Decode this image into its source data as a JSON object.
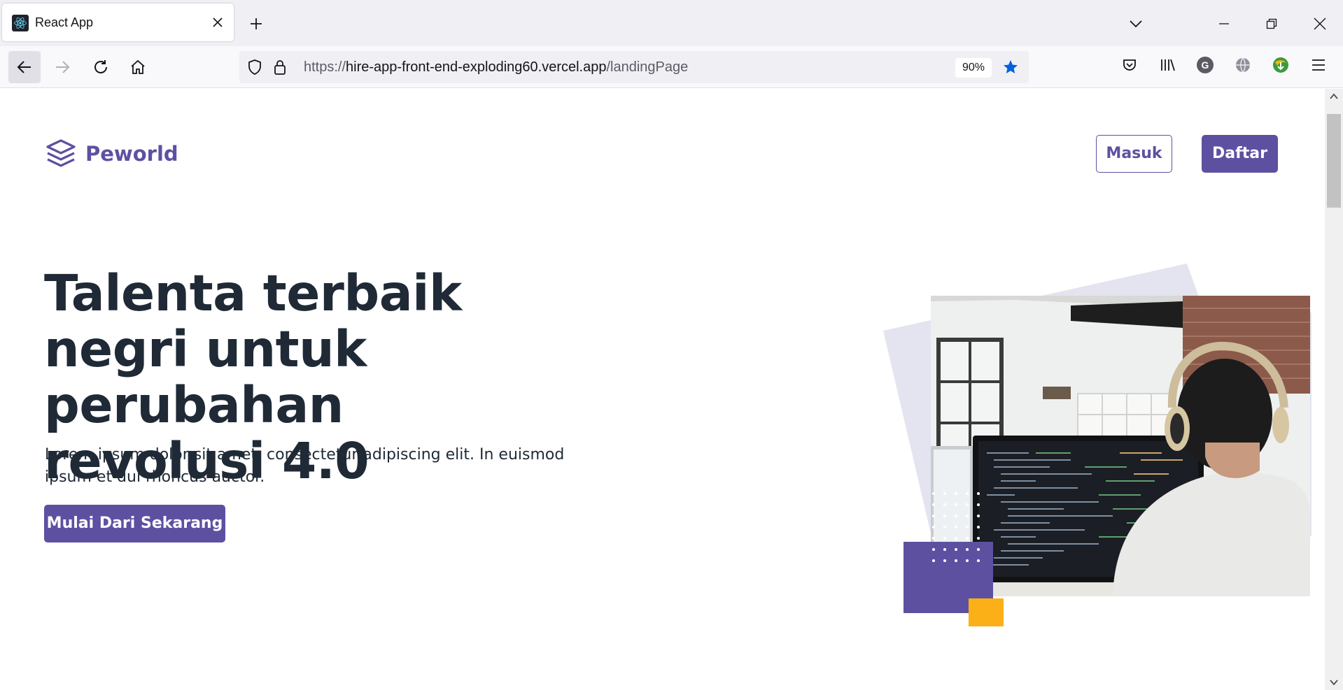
{
  "browser": {
    "tab_title": "React App",
    "url_scheme": "https://",
    "url_domain": "hire-app-front-end-exploding60.vercel.app",
    "url_path": "/landingPage",
    "zoom": "90%",
    "profile_initial": "G"
  },
  "page": {
    "logo_text": "Peworld",
    "login_label": "Masuk",
    "register_label": "Daftar",
    "hero_title": "Talenta terbaik negri untuk perubahan revolusi 4.0",
    "hero_description": "Lorem ipsum dolor sit amet, consectetur adipiscing elit. In euismod ipsum et dui rhoncus auctor.",
    "cta_label": "Mulai Dari Sekarang"
  },
  "colors": {
    "brand": "#5e50a1",
    "accent_yellow": "#fbb017",
    "text_dark": "#1f2a36"
  }
}
